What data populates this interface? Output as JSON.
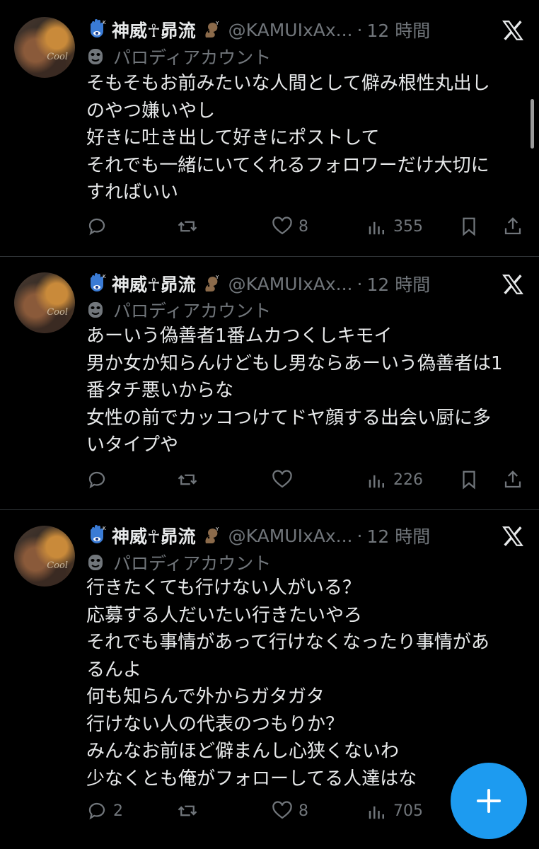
{
  "tweets": [
    {
      "display_name": "神威☥昴流",
      "handle": "@KAMUIxAx...",
      "separator": "·",
      "time": "12 時間",
      "parody_label": "パロディアカウント",
      "text": "そもそもお前みたいな人間として僻み根性丸出し\nのやつ嫌いやし\n好きに吐き出して好きにポストして\nそれでも一緒にいてくれるフォロワーだけ大切に\nすればいい",
      "replies": "",
      "reposts": "",
      "likes": "8",
      "views": "355"
    },
    {
      "display_name": "神威☥昴流",
      "handle": "@KAMUIxAx...",
      "separator": "·",
      "time": "12 時間",
      "parody_label": "パロディアカウント",
      "text": "あーいう偽善者1番ムカつくしキモイ\n男か女か知らんけどもし男ならあーいう偽善者は1\n番タチ悪いからな\n女性の前でカッコつけてドヤ顔する出会い厨に多\nいタイプや",
      "replies": "",
      "reposts": "",
      "likes": "",
      "views": "226"
    },
    {
      "display_name": "神威☥昴流",
      "handle": "@KAMUIxAx...",
      "separator": "·",
      "time": "12 時間",
      "parody_label": "パロディアカウント",
      "text": "行きたくても行けない人がいる？\n応募する人だいたい行きたいやろ\nそれでも事情があって行けなくなったり事情があ\nるんよ\n何も知らんで外からガタガタ\n行けない人の代表のつもりか？\nみんなお前ほど僻まんし心狭くないわ\n少なくとも俺がフォローしてる人達はな",
      "replies": "2",
      "reposts": "",
      "likes": "8",
      "views": "705"
    }
  ],
  "avatar_text": "Cool",
  "icons": {
    "avatar": "avatar",
    "hamsa": "hamsa-emoji-icon",
    "squirrel": "squirrel-emoji-icon",
    "mask": "performing-arts-mask-icon",
    "x_logo": "x-logo-icon",
    "reply": "reply-icon",
    "repost": "repost-icon",
    "like": "heart-icon",
    "views": "views-icon",
    "bookmark": "bookmark-icon",
    "share": "share-icon",
    "compose": "plus-icon"
  },
  "colors": {
    "background": "#000000",
    "text": "#e7e9ea",
    "muted": "#71767b",
    "accent": "#1d9bf0",
    "divider": "#2f3336"
  }
}
